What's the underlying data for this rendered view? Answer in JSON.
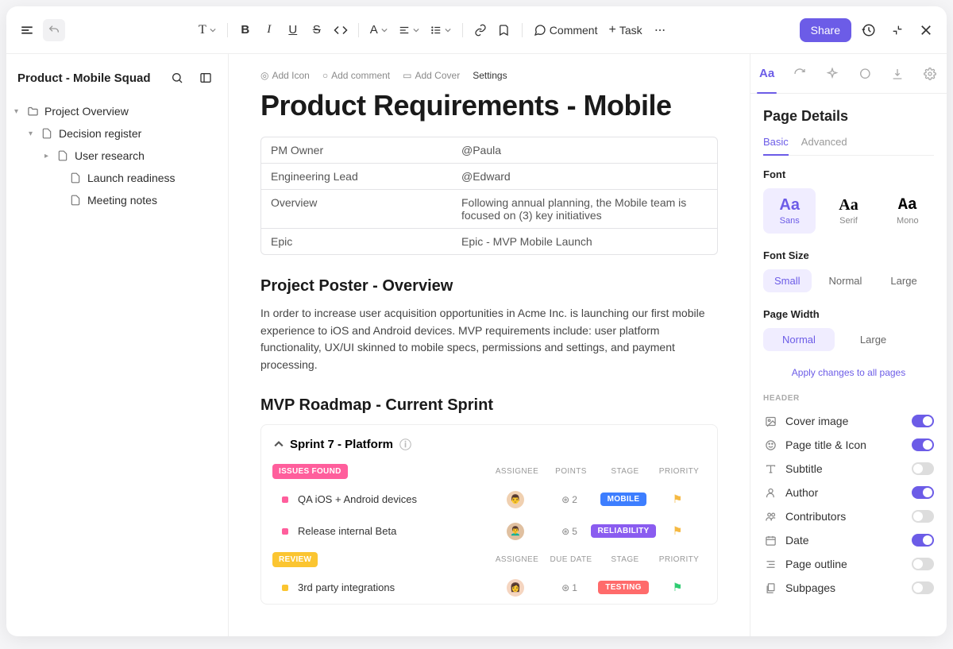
{
  "toolbar": {
    "comment_label": "Comment",
    "task_label": "Task",
    "share_label": "Share"
  },
  "sidebar": {
    "title": "Product - Mobile Squad",
    "tree": [
      {
        "label": "Project Overview"
      },
      {
        "label": "Decision register"
      },
      {
        "label": "User research"
      },
      {
        "label": "Launch readiness"
      },
      {
        "label": "Meeting notes"
      }
    ]
  },
  "doc": {
    "actions": {
      "add_icon": "Add Icon",
      "add_comment": "Add comment",
      "add_cover": "Add Cover",
      "settings": "Settings"
    },
    "title": "Product Requirements - Mobile",
    "meta": [
      {
        "key": "PM Owner",
        "val": "@Paula"
      },
      {
        "key": "Engineering Lead",
        "val": "@Edward"
      },
      {
        "key": "Overview",
        "val": "Following annual planning, the Mobile team is focused on (3) key initiatives"
      },
      {
        "key": "Epic",
        "val": "Epic - MVP Mobile Launch"
      }
    ],
    "poster_heading": "Project Poster - Overview",
    "poster_body": "In order to increase user acquisition opportunities in Acme Inc. is launching our first mobile experience to iOS and Android devices. MVP requirements include: user platform functionality, UX/UI skinned to mobile specs, permissions and settings, and payment processing.",
    "roadmap_heading": "MVP Roadmap - Current Sprint",
    "sprint": {
      "title": "Sprint  7 - Platform",
      "groups": [
        {
          "label": "ISSUES FOUND",
          "label_color": "#ff5e9c",
          "cols": [
            "ASSIGNEE",
            "POINTS",
            "STAGE",
            "PRIORITY"
          ],
          "tasks": [
            {
              "bullet": "#ff5e9c",
              "name": "QA iOS + Android devices",
              "points": "2",
              "stage": "MOBILE",
              "stage_color": "#3d7eff",
              "flag_color": "#f5b942"
            },
            {
              "bullet": "#ff5e9c",
              "name": "Release internal Beta",
              "points": "5",
              "stage": "RELIABILITY",
              "stage_color": "#8a5cf0",
              "flag_color": "#f5b942"
            }
          ]
        },
        {
          "label": "REVIEW",
          "label_color": "#fbc531",
          "cols": [
            "ASSIGNEE",
            "DUE DATE",
            "STAGE",
            "PRIORITY"
          ],
          "tasks": [
            {
              "bullet": "#fbc531",
              "name": "3rd party integrations",
              "points": "1",
              "stage": "TESTING",
              "stage_color": "#ff6b6b",
              "flag_color": "#2ecc71"
            }
          ]
        }
      ]
    }
  },
  "panel": {
    "title": "Page Details",
    "subtabs": {
      "basic": "Basic",
      "advanced": "Advanced"
    },
    "font_label": "Font",
    "fonts": [
      {
        "aa": "Aa",
        "name": "Sans"
      },
      {
        "aa": "Aa",
        "name": "Serif"
      },
      {
        "aa": "Aa",
        "name": "Mono"
      }
    ],
    "font_size_label": "Font Size",
    "font_sizes": [
      "Small",
      "Normal",
      "Large"
    ],
    "page_width_label": "Page Width",
    "page_widths": [
      "Normal",
      "Large"
    ],
    "apply_all": "Apply changes to all pages",
    "header_section": "HEADER",
    "toggles": [
      {
        "label": "Cover image",
        "on": true
      },
      {
        "label": "Page title & Icon",
        "on": true
      },
      {
        "label": "Subtitle",
        "on": false
      },
      {
        "label": "Author",
        "on": true
      },
      {
        "label": "Contributors",
        "on": false
      },
      {
        "label": "Date",
        "on": true
      },
      {
        "label": "Page outline",
        "on": false
      },
      {
        "label": "Subpages",
        "on": false
      }
    ]
  }
}
